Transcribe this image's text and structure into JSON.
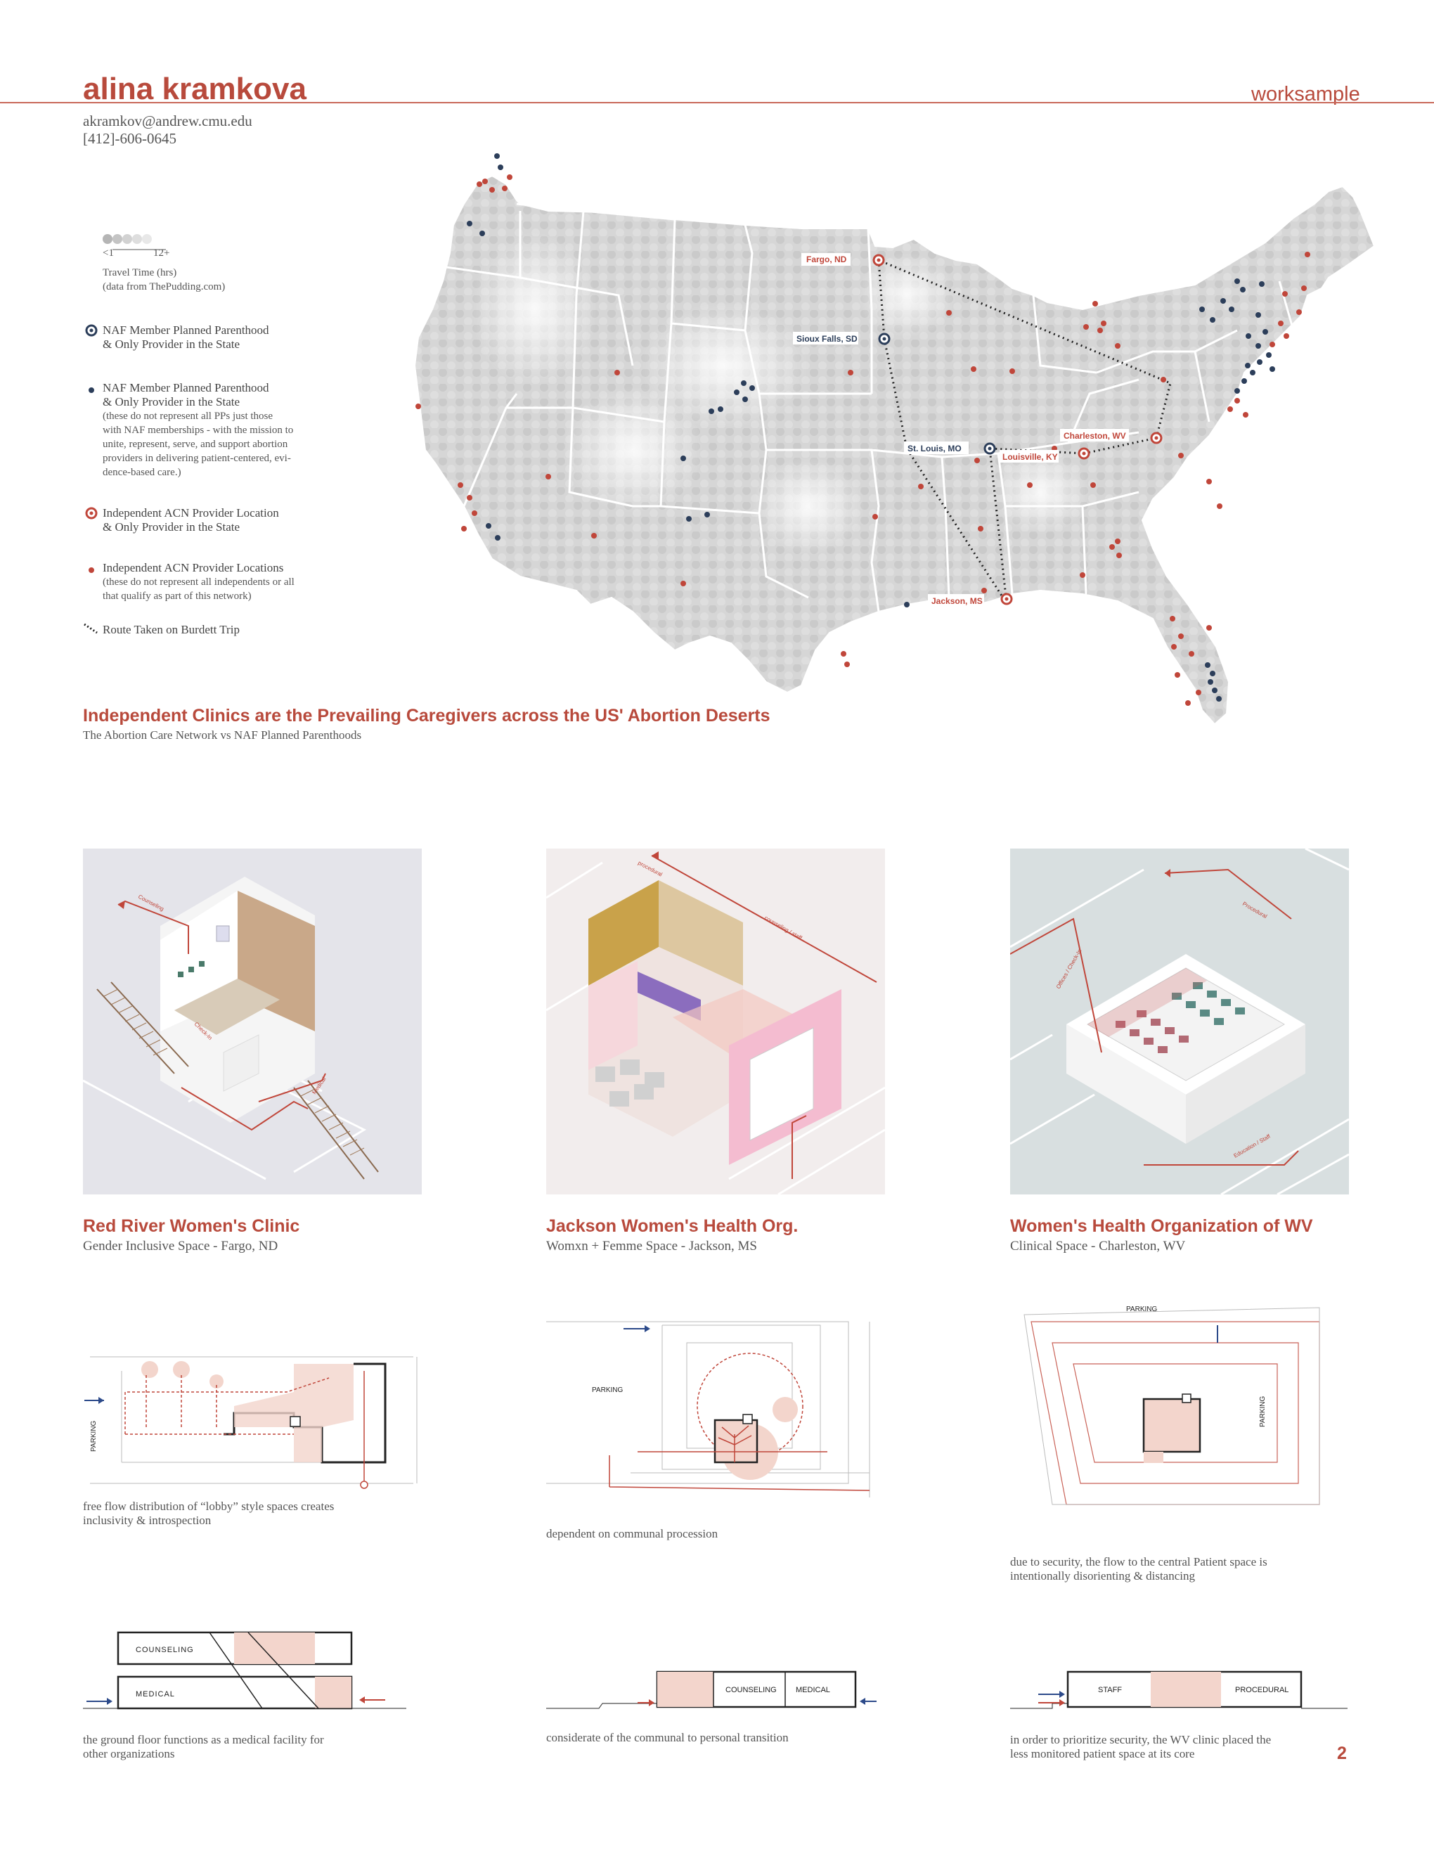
{
  "header": {
    "name": "alina kramkova",
    "tag": "worksample",
    "email": "akramkov@andrew.cmu.edu",
    "phone": "[412]-606-0645"
  },
  "legend": {
    "scale_min": "<1",
    "scale_max": "12+",
    "travel_time": "Travel Time (hrs)",
    "travel_source": "(data from ThePudding.com)",
    "naf_only_1": "NAF Member Planned Parenthood",
    "naf_only_2": "& Only Provider in the State",
    "naf_1": "NAF Member Planned Parenthood",
    "naf_2": "& Only Provider in the State",
    "naf_note_1": "(these  do  not  represent  all  PPs  just  those",
    "naf_note_2": "with  NAF  memberships  -  with  the  mission  to",
    "naf_note_3": "unite,  represent,  serve,  and  support  abortion",
    "naf_note_4": "providers  in  delivering  patient-centered,  evi-",
    "naf_note_5": "dence-based care.)",
    "acn_only_1": "Independent ACN Provider Location",
    "acn_only_2": "& Only Provider in the State",
    "acn_1": "Independent ACN Provider Locations",
    "acn_note_1": "(these do not represent all independents or all",
    "acn_note_2": "that qualify as part of this network)",
    "route": "Route Taken on Burdett Trip"
  },
  "map": {
    "title": "Independent Clinics are the Prevailing Caregivers across the US' Abortion Deserts",
    "subtitle": "The Abortion Care Network vs NAF Planned Parenthoods",
    "cities": {
      "fargo": "Fargo, ND",
      "sioux": "Sioux Falls, SD",
      "stlouis": "St. Louis, MO",
      "louisville": "Louisville, KY",
      "charleston": "Charleston, WV",
      "jackson": "Jackson, MS"
    },
    "colors": {
      "red": "#c0463a",
      "navy": "#2c3e5a",
      "land": "#d4d4d4"
    }
  },
  "projects": [
    {
      "title": "Red River Women's Clinic",
      "subtitle": "Gender Inclusive Space - Fargo, ND",
      "plan_caption_1": "free flow distribution of “lobby” style spaces creates",
      "plan_caption_2": "inclusivity & introspection",
      "section_caption_1": "the ground floor functions as a medical facility for",
      "section_caption_2": "other organizations",
      "plan_label": "PARKING",
      "section_labels": [
        "COUNSELING",
        "MEDICAL"
      ],
      "iso_labels": [
        "Counseling",
        "Check-In",
        "Medical"
      ]
    },
    {
      "title": "Jackson Women's Health Org.",
      "subtitle": "Womxn + Femme Space - Jackson, MS",
      "plan_caption_1": "dependent on communal procession",
      "section_caption_1": "considerate of the communal to personal transition",
      "plan_label": "PARKING",
      "section_labels": [
        "COUNSELING",
        "MEDICAL"
      ],
      "iso_labels": [
        "procedural",
        "counseling / staff"
      ]
    },
    {
      "title": "Women's Health Organization of WV",
      "subtitle": "Clinical Space - Charleston, WV",
      "plan_caption_1": "due to security, the flow to the central Patient space is",
      "plan_caption_2": "intentionally disorienting & distancing",
      "section_caption_1": "in order to prioritize security, the WV clinic placed the",
      "section_caption_2": "less monitored patient space at its core",
      "plan_labels": [
        "PARKING",
        "PARKING"
      ],
      "section_labels": [
        "STAFF",
        "PROCEDURAL"
      ],
      "iso_labels": [
        "Procedural",
        "Offices / Check-In",
        "Education / Staff"
      ]
    }
  ],
  "page_number": "2"
}
